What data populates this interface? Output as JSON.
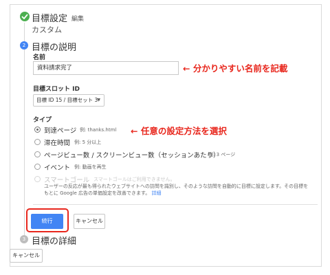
{
  "step1": {
    "number": "1",
    "title": "目標設定",
    "edit_label": "編集",
    "subtitle": "カスタム"
  },
  "step2": {
    "number": "2",
    "title": "目標の説明",
    "name_label": "名前",
    "name_value": "資料請求完了",
    "name_annotation": "← 分かりやすい名前を記載",
    "slot_label": "目標スロット ID",
    "slot_value": "目標 ID 15 / 目標セット 3",
    "type_label": "タイプ",
    "type_annotation": "← 任意の設定方法を選択",
    "options": [
      {
        "label": "到達ページ",
        "example": "例: thanks.html",
        "selected": true,
        "disabled": false
      },
      {
        "label": "滞在時間",
        "example": "例: 5 分以上",
        "selected": false,
        "disabled": false
      },
      {
        "label": "ページビュー数 / スクリーンビュー数（セッションあたり）",
        "example": "例: 3 ページ",
        "selected": false,
        "disabled": false
      },
      {
        "label": "イベント",
        "example": "例: 動画を再生",
        "selected": false,
        "disabled": false
      },
      {
        "label": "スマートゴール",
        "example": "スマートゴールはご利用できません。",
        "selected": false,
        "disabled": true
      }
    ],
    "smart_goal_desc_line1": "ユーザーの反応が最も得られたウェブサイトへの訪問を識別し、そのような訪問を自動的に目標に設定します。その目標を",
    "smart_goal_desc_line2": "もとに Google 広告の単価設定を改善できます。",
    "details_link": "詳細",
    "continue_label": "続行",
    "cancel_label": "キャンセル"
  },
  "step3": {
    "number": "3",
    "title": "目標の詳細"
  },
  "footer": {
    "cancel_label": "キャンセル"
  },
  "colors": {
    "accent_blue": "#4285f4",
    "success_green": "#4caf50",
    "annotation_red": "#e8261c"
  }
}
